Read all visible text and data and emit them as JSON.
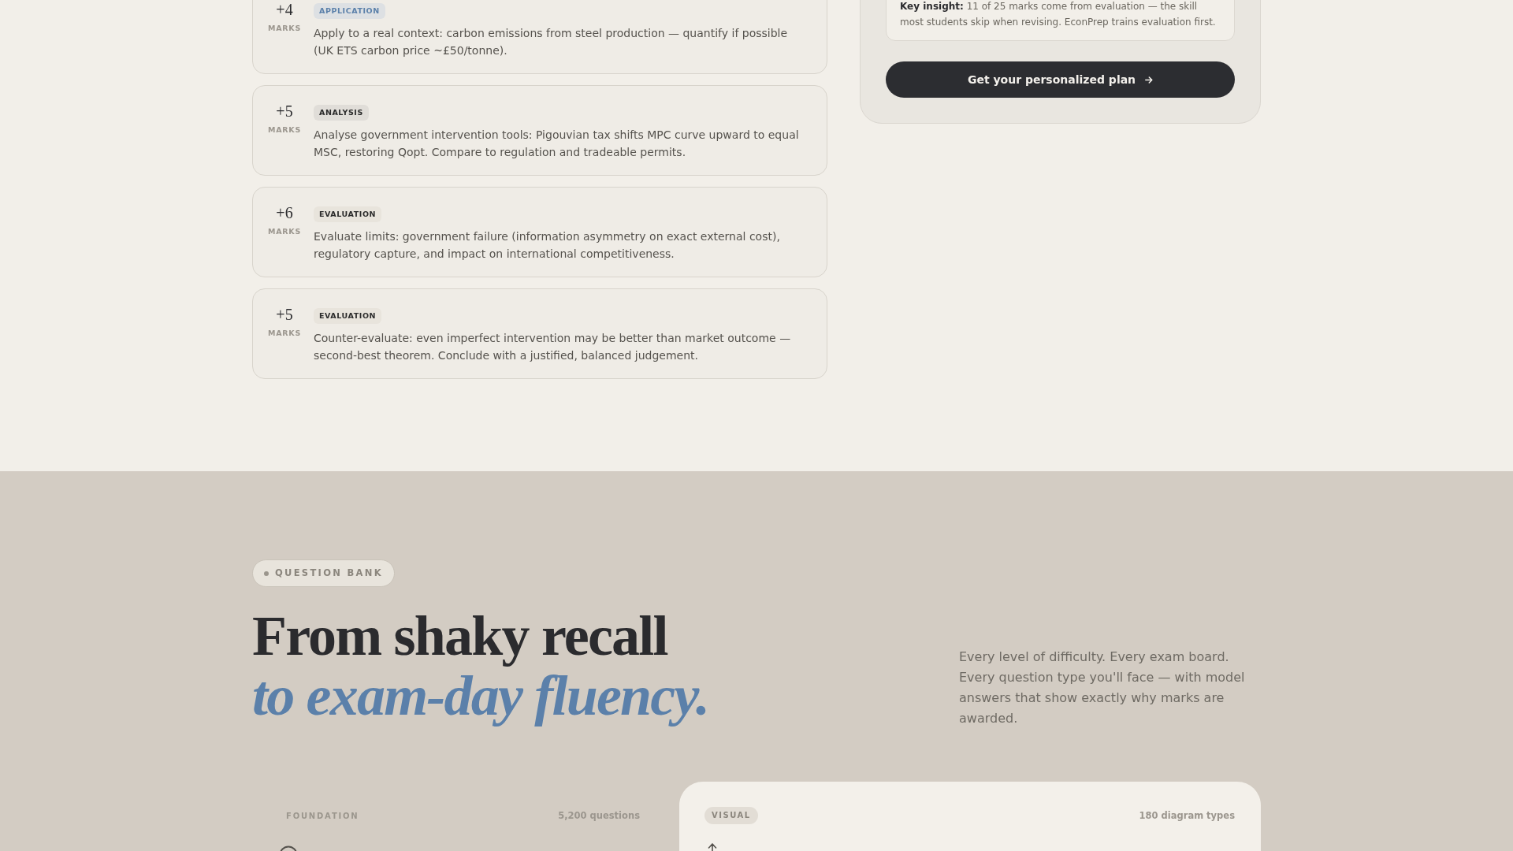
{
  "mark_scheme": {
    "criteria": [
      {
        "marks": "+4",
        "marks_unit": "MARKS",
        "tag": "APPLICATION",
        "kind": "application",
        "description": "Apply to a real context: carbon emissions from steel production — quantify if possible (UK ETS carbon price ~£50/tonne)."
      },
      {
        "marks": "+5",
        "marks_unit": "MARKS",
        "tag": "ANALYSIS",
        "kind": "analysis",
        "description": "Analyse government intervention tools: Pigouvian tax shifts MPC curve upward to equal MSC, restoring Qopt. Compare to regulation and tradeable permits."
      },
      {
        "marks": "+6",
        "marks_unit": "MARKS",
        "tag": "EVALUATION",
        "kind": "evaluation",
        "description": "Evaluate limits: government failure (information asymmetry on exact external cost), regulatory capture, and impact on international competitiveness."
      },
      {
        "marks": "+5",
        "marks_unit": "MARKS",
        "tag": "EVALUATION",
        "kind": "evaluation",
        "description": "Counter-evaluate: even imperfect intervention may be better than market outcome — second-best theorem. Conclude with a justified, balanced judgement."
      }
    ]
  },
  "summary_panel": {
    "insight": "**Key insight:** 11 of 25 marks come from evaluation — the skill most students skip when revising. EconPrep trains evaluation first.",
    "button": "Get your personalized plan"
  },
  "question_bank": {
    "eyebrow": "QUESTION BANK",
    "headline": "From shaky recall *to exam-day fluency.*",
    "description": "Every level of difficulty. Every exam board. Every question type you'll face — with model answers that show exactly why marks are awarded.",
    "categories": [
      {
        "kind": "plain",
        "label": "FOUNDATION",
        "count": "5,200 questions"
      },
      {
        "kind": "featured",
        "label": "VISUAL",
        "count": "180 diagram types"
      }
    ]
  }
}
